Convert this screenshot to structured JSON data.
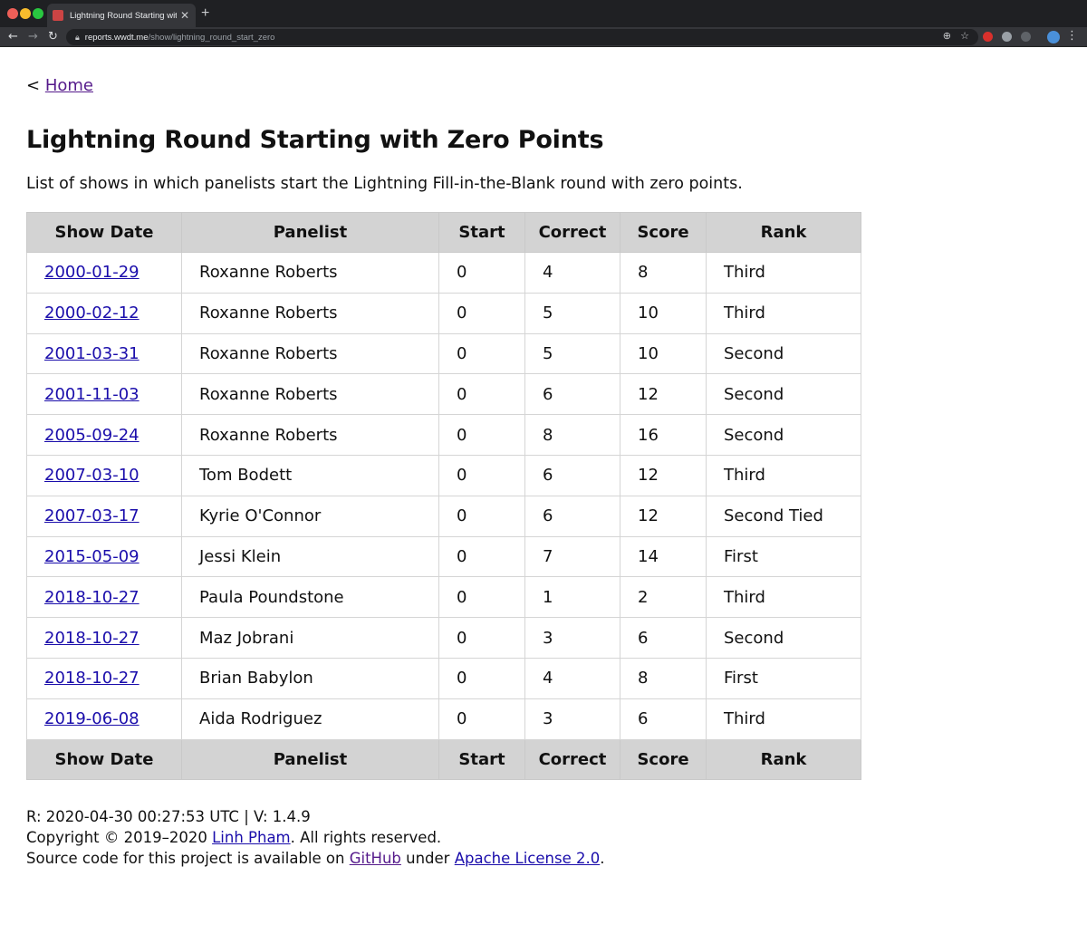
{
  "browser": {
    "tab_title": "Lightning Round Starting with Zero Points",
    "url_host": "reports.wwdt.me",
    "url_path": "/show/lightning_round_start_zero"
  },
  "nav": {
    "home_prefix": "<",
    "home_label": "Home"
  },
  "page": {
    "title": "Lightning Round Starting with Zero Points",
    "description": "List of shows in which panelists start the Lightning Fill-in-the-Blank round with zero points."
  },
  "table": {
    "columns": [
      "Show Date",
      "Panelist",
      "Start",
      "Correct",
      "Score",
      "Rank"
    ],
    "rows": [
      {
        "date": "2000-01-29",
        "panelist": "Roxanne Roberts",
        "start": "0",
        "correct": "4",
        "score": "8",
        "rank": "Third"
      },
      {
        "date": "2000-02-12",
        "panelist": "Roxanne Roberts",
        "start": "0",
        "correct": "5",
        "score": "10",
        "rank": "Third"
      },
      {
        "date": "2001-03-31",
        "panelist": "Roxanne Roberts",
        "start": "0",
        "correct": "5",
        "score": "10",
        "rank": "Second"
      },
      {
        "date": "2001-11-03",
        "panelist": "Roxanne Roberts",
        "start": "0",
        "correct": "6",
        "score": "12",
        "rank": "Second"
      },
      {
        "date": "2005-09-24",
        "panelist": "Roxanne Roberts",
        "start": "0",
        "correct": "8",
        "score": "16",
        "rank": "Second"
      },
      {
        "date": "2007-03-10",
        "panelist": "Tom Bodett",
        "start": "0",
        "correct": "6",
        "score": "12",
        "rank": "Third"
      },
      {
        "date": "2007-03-17",
        "panelist": "Kyrie O'Connor",
        "start": "0",
        "correct": "6",
        "score": "12",
        "rank": "Second Tied"
      },
      {
        "date": "2015-05-09",
        "panelist": "Jessi Klein",
        "start": "0",
        "correct": "7",
        "score": "14",
        "rank": "First"
      },
      {
        "date": "2018-10-27",
        "panelist": "Paula Poundstone",
        "start": "0",
        "correct": "1",
        "score": "2",
        "rank": "Third"
      },
      {
        "date": "2018-10-27",
        "panelist": "Maz Jobrani",
        "start": "0",
        "correct": "3",
        "score": "6",
        "rank": "Second"
      },
      {
        "date": "2018-10-27",
        "panelist": "Brian Babylon",
        "start": "0",
        "correct": "4",
        "score": "8",
        "rank": "First"
      },
      {
        "date": "2019-06-08",
        "panelist": "Aida Rodriguez",
        "start": "0",
        "correct": "3",
        "score": "6",
        "rank": "Third"
      }
    ]
  },
  "footer": {
    "render_info": "R: 2020-04-30 00:27:53 UTC | V: 1.4.9",
    "copyright_prefix": "Copyright © 2019–2020 ",
    "author": "Linh Pham",
    "copyright_suffix": ". All rights reserved.",
    "source_prefix": "Source code for this project is available on ",
    "github_label": "GitHub",
    "source_middle": " under ",
    "license_label": "Apache License 2.0",
    "source_suffix": "."
  },
  "colors": {
    "link": "#1a0dab",
    "visited_link": "#551a8b",
    "header_bg": "#d3d3d3"
  }
}
